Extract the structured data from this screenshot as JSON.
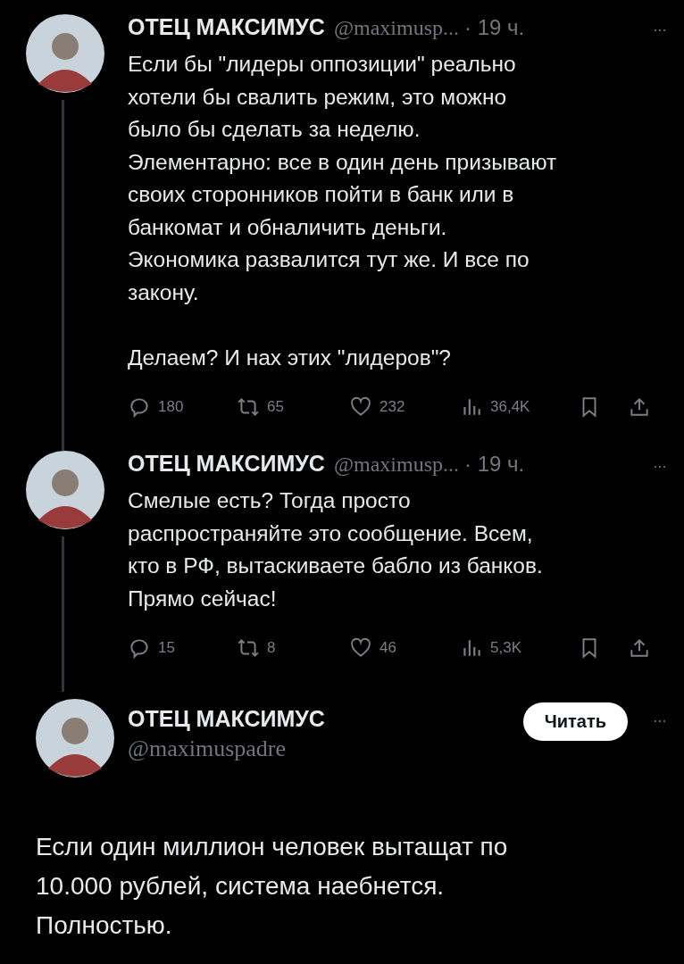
{
  "thread": [
    {
      "name": "ОТЕЦ МАКСИМУС",
      "handle": "@maximusp...",
      "time": "· 19 ч.",
      "more": "···",
      "body": "Если бы \"лидеры оппозиции\" реально\nхотели бы свалить режим, это можно\nбыло бы сделать за неделю.\nЭлементарно: все в один день призывают\nсвоих сторонников пойти в банк или в\nбанкомат и обналичить деньги.\nЭкономика развалится тут же. И все по\nзакону.\n\nДелаем? И нах этих \"лидеров\"?",
      "replies": "180",
      "reposts": "65",
      "likes": "232",
      "views": "36,4K"
    },
    {
      "name": "ОТЕЦ МАКСИМУС",
      "handle": "@maximusp...",
      "time": "· 19 ч.",
      "more": "···",
      "body": "Смелые есть? Тогда просто\nраспространяйте это сообщение. Всем,\nкто в РФ, вытаскиваете бабло из банков.\nПрямо сейчас!",
      "replies": "15",
      "reposts": "8",
      "likes": "46",
      "views": "5,3K"
    }
  ],
  "main": {
    "name": "ОТЕЦ МАКСИМУС",
    "handle": "@maximuspadre",
    "follow": "Читать",
    "more": "···",
    "body": "Если один миллион человек вытащат по\n10.000 рублей, система наебнется.\nПолностью."
  }
}
